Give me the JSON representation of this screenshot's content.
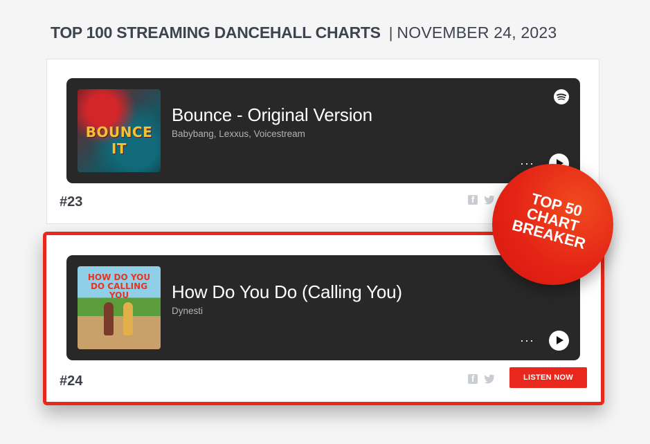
{
  "header": {
    "title": "TOP 100 STREAMING DANCEHALL CHARTS",
    "separator": "|",
    "date": "NOVEMBER 24, 2023"
  },
  "tracks": [
    {
      "rank": "#23",
      "title": "Bounce - Original Version",
      "artists": "Babybang, Lexxus, Voicestream",
      "art_text": "BOUNCE IT",
      "icons": [
        "spotify-logo-icon",
        "more-options-icon",
        "play-icon",
        "facebook-icon",
        "twitter-icon"
      ]
    },
    {
      "rank": "#24",
      "title": "How Do You Do (Calling You)",
      "artists": "Dynesti",
      "art_text": "HOW DO YOU DO CALLING YOU",
      "more": "···",
      "listen_label": "LISTEN NOW",
      "icons": [
        "more-options-icon",
        "play-icon",
        "facebook-icon",
        "twitter-icon"
      ]
    }
  ],
  "badge": {
    "lines": [
      "TOP 50",
      "CHART",
      "BREAKER"
    ]
  },
  "colors": {
    "accent": "#e8281c",
    "embed_bg": "#282828",
    "heading": "#3d4450"
  }
}
